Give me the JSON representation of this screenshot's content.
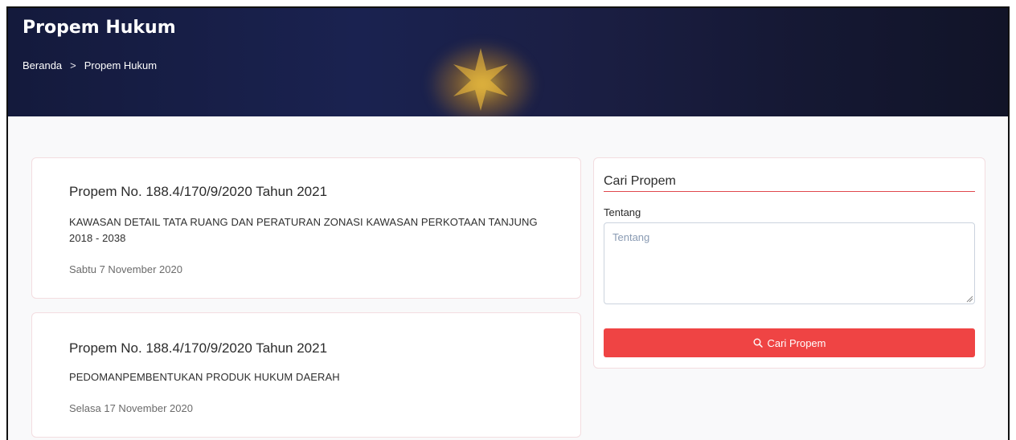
{
  "header": {
    "title": "Propem Hukum",
    "breadcrumb": [
      {
        "label": "Beranda"
      },
      {
        "label": "Propem Hukum"
      }
    ],
    "separator": ">"
  },
  "listings": [
    {
      "title": "Propem No. 188.4/170/9/2020 Tahun 2021",
      "description": "KAWASAN DETAIL TATA RUANG DAN PERATURAN ZONASI KAWASAN PERKOTAAN TANJUNG 2018 - 2038",
      "date": "Sabtu 7 November 2020"
    },
    {
      "title": "Propem No. 188.4/170/9/2020 Tahun 2021",
      "description": "PEDOMANPEMBENTUKAN PRODUK HUKUM DAERAH",
      "date": "Selasa 17 November 2020"
    }
  ],
  "search": {
    "title": "Cari Propem",
    "field_label": "Tentang",
    "placeholder": "Tentang",
    "value": "",
    "button_label": "Cari Propem",
    "button_icon": "search-icon"
  },
  "colors": {
    "accent": "#ef4444",
    "header_bg": "#161b3f",
    "divider": "#e0484d"
  }
}
